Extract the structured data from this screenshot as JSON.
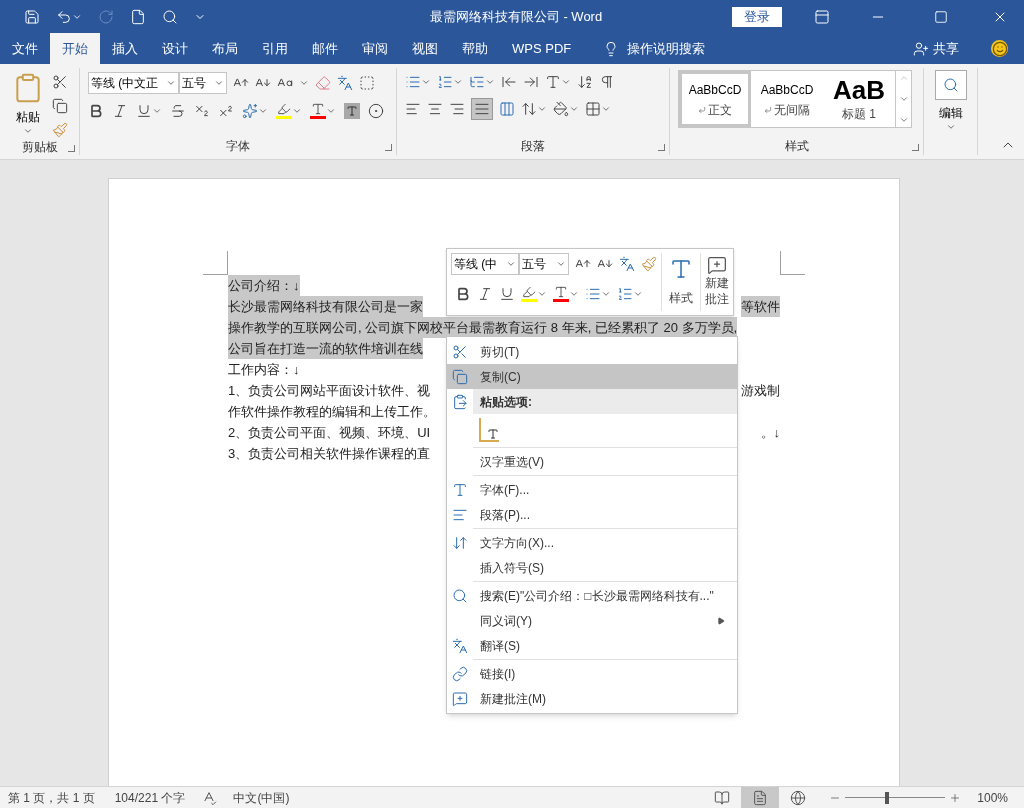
{
  "title_bar": {
    "title": "最需网络科技有限公司 - Word",
    "login": "登录"
  },
  "tabs": [
    {
      "label": "文件",
      "selected": false
    },
    {
      "label": "开始",
      "selected": true
    },
    {
      "label": "插入",
      "selected": false
    },
    {
      "label": "设计",
      "selected": false
    },
    {
      "label": "布局",
      "selected": false
    },
    {
      "label": "引用",
      "selected": false
    },
    {
      "label": "邮件",
      "selected": false
    },
    {
      "label": "审阅",
      "selected": false
    },
    {
      "label": "视图",
      "selected": false
    },
    {
      "label": "帮助",
      "selected": false
    },
    {
      "label": "WPS PDF",
      "selected": false
    }
  ],
  "tell_me": "操作说明搜索",
  "share": "共享",
  "ribbon": {
    "clipboard": {
      "paste": "粘贴",
      "label": "剪贴板"
    },
    "font": {
      "name": "等线 (中文正",
      "size": "五号",
      "label": "字体"
    },
    "paragraph": {
      "label": "段落"
    },
    "styles": {
      "label": "样式",
      "items": [
        {
          "preview": "AaBbCcD",
          "label": "正文",
          "selected": true,
          "kind": "normal"
        },
        {
          "preview": "AaBbCcD",
          "label": "无间隔",
          "selected": false,
          "kind": "normal"
        },
        {
          "preview": "AaB",
          "label": "标题 1",
          "selected": false,
          "kind": "heading"
        }
      ]
    },
    "editing": {
      "label": "编辑"
    }
  },
  "document": {
    "lines": [
      {
        "left": "公司介绍：↓",
        "selected": true
      },
      {
        "left": "长沙最需网络科技有限公司是一家",
        "right": "等软件",
        "selected": true
      },
      {
        "left": "操作教学的互联网公司, 公司旗下网校平台最需教育运行 8 年来, 已经累积了 20 多万学员,",
        "selected": true
      },
      {
        "left": "公司旨在打造一流的软件培训在线",
        "selected": true
      },
      {
        "left": "工作内容：↓",
        "selected": false
      },
      {
        "left": "1、负责公司网站平面设计软件、视",
        "right": "游戏制",
        "selected": false
      },
      {
        "left": "作软件操作教程的编辑和上传工作。",
        "selected": false
      },
      {
        "left": "2、负责公司平面、视频、环境、UI",
        "right": "。↓",
        "selected": false
      },
      {
        "left": "3、负责公司相关软件操作课程的直",
        "selected": false
      }
    ]
  },
  "mini_toolbar": {
    "font": "等线 (中",
    "size": "五号",
    "styles": "样式",
    "comment": "新建批注"
  },
  "context_menu": {
    "groups": [
      [
        {
          "kind": "command",
          "label": "剪切(T)",
          "selected": false,
          "submenu": false
        },
        {
          "kind": "command",
          "label": "复制(C)",
          "selected": true,
          "submenu": false
        },
        {
          "kind": "header",
          "label": "粘贴选项:"
        },
        {
          "kind": "paste-option"
        }
      ],
      [
        {
          "kind": "command",
          "label": "汉字重选(V)",
          "selected": false,
          "submenu": false
        }
      ],
      [
        {
          "kind": "command",
          "label": "字体(F)...",
          "selected": false,
          "submenu": false
        },
        {
          "kind": "command",
          "label": "段落(P)...",
          "selected": false,
          "submenu": false
        }
      ],
      [
        {
          "kind": "command",
          "label": "文字方向(X)...",
          "selected": false,
          "submenu": false
        },
        {
          "kind": "command",
          "label": "插入符号(S)",
          "selected": false,
          "submenu": false
        }
      ],
      [
        {
          "kind": "command",
          "label": "搜索(E)\"公司介绍：□长沙最需网络科技有...\"",
          "selected": false,
          "submenu": false
        },
        {
          "kind": "command",
          "label": "同义词(Y)",
          "selected": false,
          "submenu": true
        },
        {
          "kind": "command",
          "label": "翻译(S)",
          "selected": false,
          "submenu": false
        }
      ],
      [
        {
          "kind": "command",
          "label": "链接(I)",
          "selected": false,
          "submenu": false
        },
        {
          "kind": "command",
          "label": "新建批注(M)",
          "selected": false,
          "submenu": false
        }
      ]
    ]
  },
  "status_bar": {
    "page": "第 1 页，共 1 页",
    "words": "104/221 个字",
    "language": "中文(中国)",
    "views": [
      {
        "selected": false
      },
      {
        "selected": true
      },
      {
        "selected": false
      }
    ],
    "zoom": {
      "level": 0.42,
      "reading": "100%"
    }
  }
}
